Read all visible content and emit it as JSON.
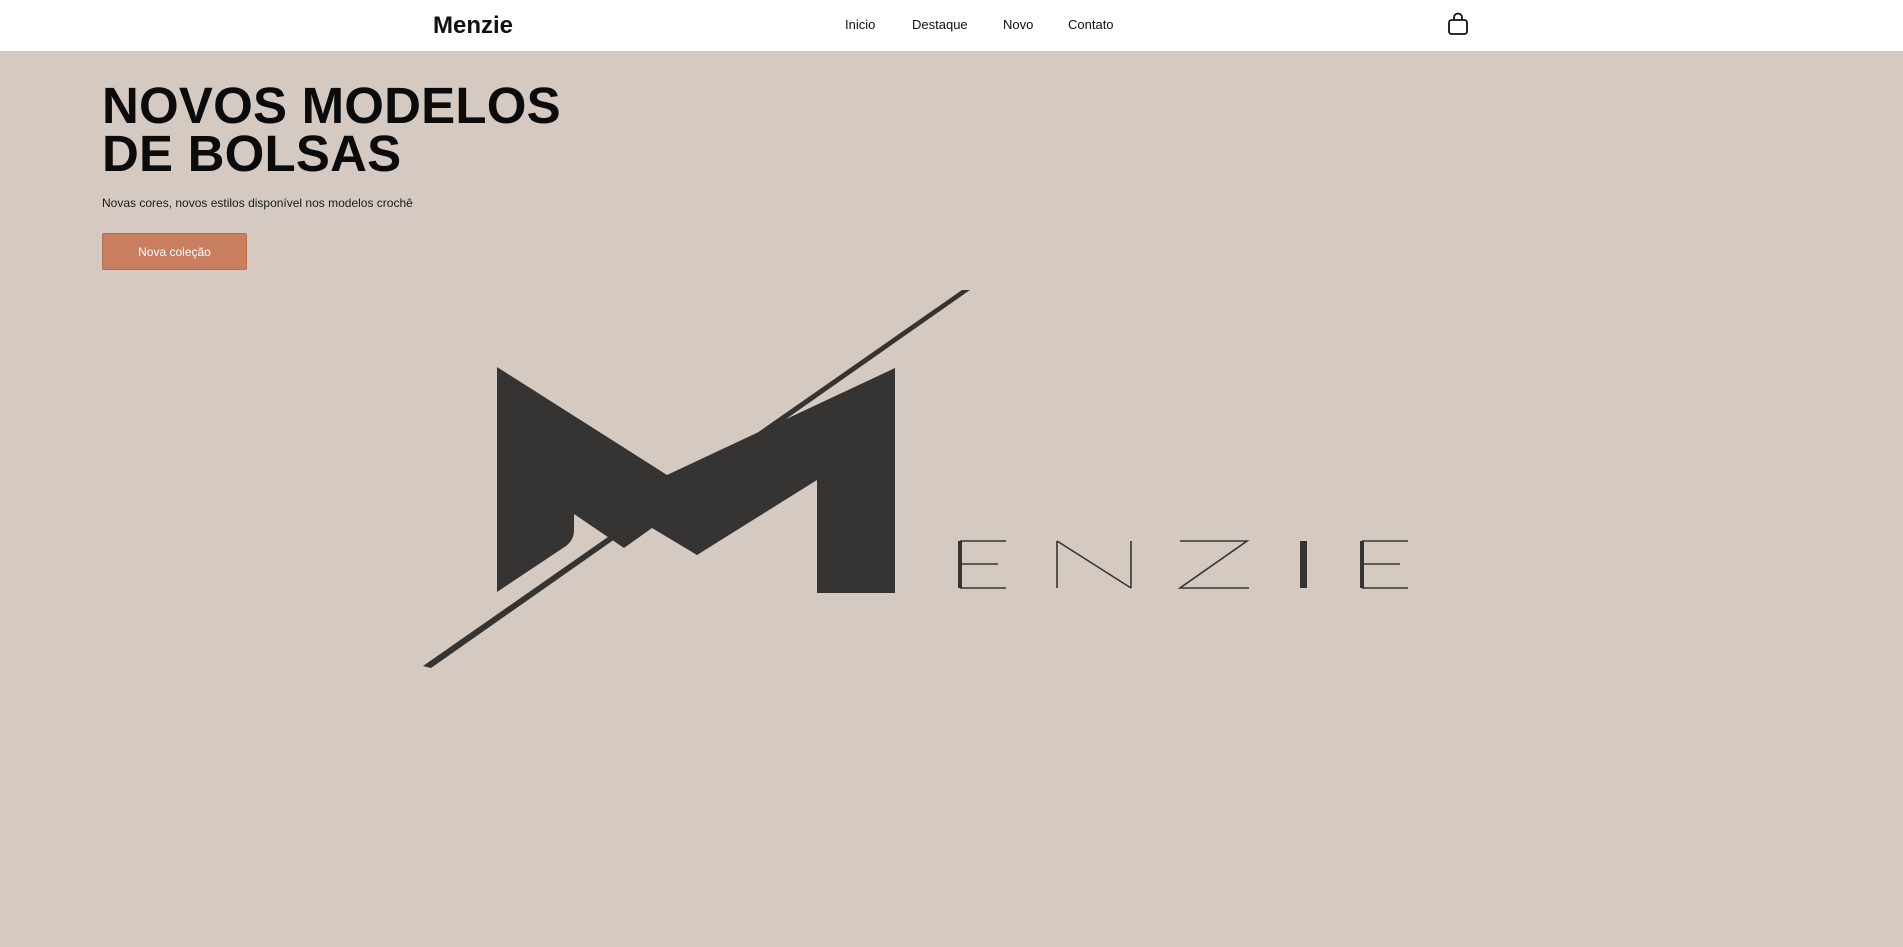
{
  "header": {
    "brand": "Menzie",
    "nav": [
      "Inicio",
      "Destaque",
      "Novo",
      "Contato"
    ],
    "cart_icon": "shopping-bag-icon"
  },
  "hero": {
    "title_line1": "NOVOS MODELOS",
    "title_line2": "DE BOLSAS",
    "subtitle": "Novas cores, novos estilos disponível nos modelos crochê",
    "cta_label": "Nova coleção"
  },
  "logo": {
    "name": "Menzie logo",
    "wordmark": "MENZIE"
  },
  "colors": {
    "background": "#d5cac1",
    "header": "#ffffff",
    "accent": "#c97f5f",
    "logo": "#363432"
  }
}
